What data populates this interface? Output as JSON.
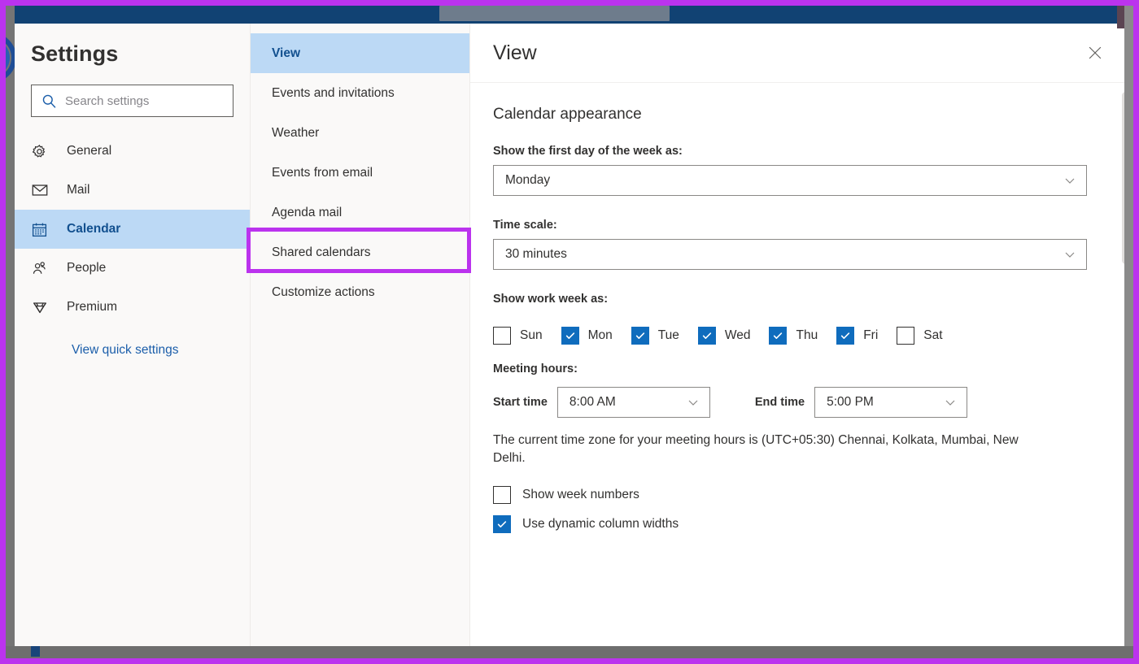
{
  "window": {
    "accent_purple": "#bb33ee",
    "navy": "#114273",
    "chrome_gray": "#757575"
  },
  "settings": {
    "title": "Settings",
    "search": {
      "placeholder": "Search settings",
      "value": "",
      "icon": "search-icon"
    },
    "nav_items": [
      {
        "label": "General",
        "icon": "gear-icon",
        "selected": false
      },
      {
        "label": "Mail",
        "icon": "envelope-icon",
        "selected": false
      },
      {
        "label": "Calendar",
        "icon": "calendar-icon",
        "selected": true
      },
      {
        "label": "People",
        "icon": "people-icon",
        "selected": false
      },
      {
        "label": "Premium",
        "icon": "diamond-icon",
        "selected": false
      }
    ],
    "quick_settings_link": "View quick settings"
  },
  "subnav": {
    "items": [
      {
        "label": "View",
        "selected": true,
        "highlighted": false
      },
      {
        "label": "Events and invitations",
        "selected": false,
        "highlighted": false
      },
      {
        "label": "Weather",
        "selected": false,
        "highlighted": false
      },
      {
        "label": "Events from email",
        "selected": false,
        "highlighted": false
      },
      {
        "label": "Agenda mail",
        "selected": false,
        "highlighted": false
      },
      {
        "label": "Shared calendars",
        "selected": false,
        "highlighted": true
      },
      {
        "label": "Customize actions",
        "selected": false,
        "highlighted": false
      }
    ],
    "highlight_color": "#bb33ee"
  },
  "content": {
    "title": "View",
    "close_icon": "close-icon",
    "section_title": "Calendar appearance",
    "first_day": {
      "label": "Show the first day of the week as:",
      "value": "Monday"
    },
    "time_scale": {
      "label": "Time scale:",
      "value": "30 minutes"
    },
    "work_week": {
      "label": "Show work week as:",
      "days": [
        {
          "label": "Sun",
          "checked": false
        },
        {
          "label": "Mon",
          "checked": true
        },
        {
          "label": "Tue",
          "checked": true
        },
        {
          "label": "Wed",
          "checked": true
        },
        {
          "label": "Thu",
          "checked": true
        },
        {
          "label": "Fri",
          "checked": true
        },
        {
          "label": "Sat",
          "checked": false
        }
      ]
    },
    "meeting_hours": {
      "label": "Meeting hours:",
      "start_label": "Start time",
      "start_value": "8:00 AM",
      "end_label": "End time",
      "end_value": "5:00 PM",
      "timezone_note": "The current time zone for your meeting hours is (UTC+05:30) Chennai, Kolkata, Mumbai, New Delhi."
    },
    "options": [
      {
        "label": "Show week numbers",
        "checked": false
      },
      {
        "label": "Use dynamic column widths",
        "checked": true
      }
    ]
  }
}
